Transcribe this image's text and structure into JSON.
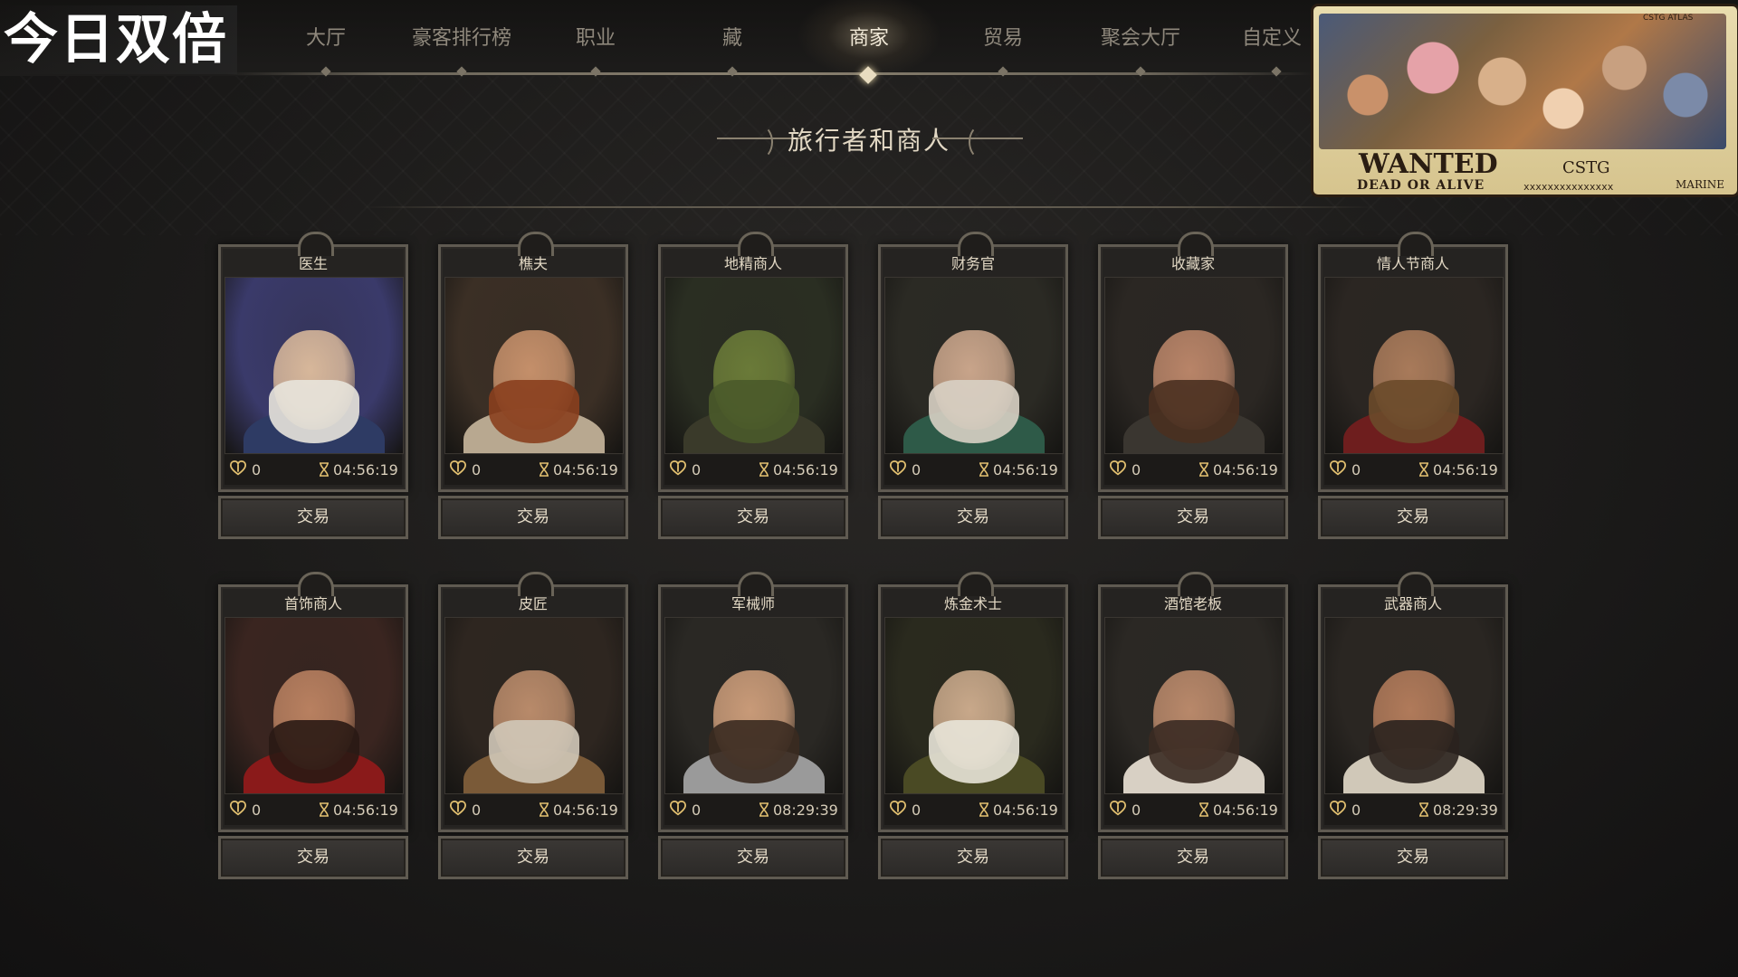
{
  "overlay": {
    "double_text": "今日双倍",
    "wanted": {
      "art_label": "CSTG ATLAS",
      "title": "WANTED",
      "subtitle": "DEAD OR ALIVE",
      "name": "CSTG",
      "bounty": "xxxxxxxxxxxxxxx",
      "marine": "MARINE"
    }
  },
  "nav": {
    "items": [
      {
        "label": "大厅"
      },
      {
        "label": "豪客排行榜"
      },
      {
        "label": "职业"
      },
      {
        "label": "藏"
      },
      {
        "label": "商家"
      },
      {
        "label": "贸易"
      },
      {
        "label": "聚会大厅"
      },
      {
        "label": "自定义"
      }
    ],
    "active_index": 4
  },
  "section": {
    "title": "旅行者和商人"
  },
  "merchants": [
    {
      "name": "医生",
      "favor": "0",
      "timer": "04:56:19",
      "button": "交易",
      "palette": [
        "#3a3a6a",
        "#d7b79a",
        "#e8e4dc",
        "#2e3b64"
      ]
    },
    {
      "name": "樵夫",
      "favor": "0",
      "timer": "04:56:19",
      "button": "交易",
      "palette": [
        "#3b2f25",
        "#c48f6a",
        "#8a3f1e",
        "#b8a890"
      ]
    },
    {
      "name": "地精商人",
      "favor": "0",
      "timer": "04:56:19",
      "button": "交易",
      "palette": [
        "#2a2e22",
        "#6a7a38",
        "#4a5a2a",
        "#3a3a2a"
      ]
    },
    {
      "name": "财务官",
      "favor": "0",
      "timer": "04:56:19",
      "button": "交易",
      "palette": [
        "#2b2a24",
        "#c8a48a",
        "#d8d0c4",
        "#2e5a48"
      ]
    },
    {
      "name": "收藏家",
      "favor": "0",
      "timer": "04:56:19",
      "button": "交易",
      "palette": [
        "#2b2723",
        "#b88468",
        "#4a3020",
        "#3a3630"
      ]
    },
    {
      "name": "情人节商人",
      "favor": "0",
      "timer": "04:56:19",
      "button": "交易",
      "palette": [
        "#2b2622",
        "#a87a5a",
        "#6a4a2a",
        "#6e1e1e"
      ]
    },
    {
      "name": "首饰商人",
      "favor": "0",
      "timer": "04:56:19",
      "button": "交易",
      "palette": [
        "#3a2520",
        "#b88060",
        "#2a1a14",
        "#8a1a1a"
      ]
    },
    {
      "name": "皮匠",
      "favor": "0",
      "timer": "04:56:19",
      "button": "交易",
      "palette": [
        "#2e2620",
        "#b88a6a",
        "#d0c8b8",
        "#7a5a38"
      ]
    },
    {
      "name": "军械师",
      "favor": "0",
      "timer": "08:29:39",
      "button": "交易",
      "palette": [
        "#2a2824",
        "#c89a78",
        "#3a2a20",
        "#9a9a9a"
      ]
    },
    {
      "name": "炼金术士",
      "favor": "0",
      "timer": "04:56:19",
      "button": "交易",
      "palette": [
        "#2a2a1e",
        "#c8a88a",
        "#e8e4d8",
        "#4a4a24"
      ]
    },
    {
      "name": "酒馆老板",
      "favor": "0",
      "timer": "04:56:19",
      "button": "交易",
      "palette": [
        "#2b2824",
        "#b8886a",
        "#3a2a22",
        "#d8d0c4"
      ]
    },
    {
      "name": "武器商人",
      "favor": "0",
      "timer": "08:29:39",
      "button": "交易",
      "palette": [
        "#2a2622",
        "#b07a5a",
        "#2a221e",
        "#d0c8b8"
      ]
    }
  ],
  "colors": {
    "accent": "#e8dcc0",
    "favor_heart": "#e2c070",
    "timer_icon": "#e2c070"
  }
}
